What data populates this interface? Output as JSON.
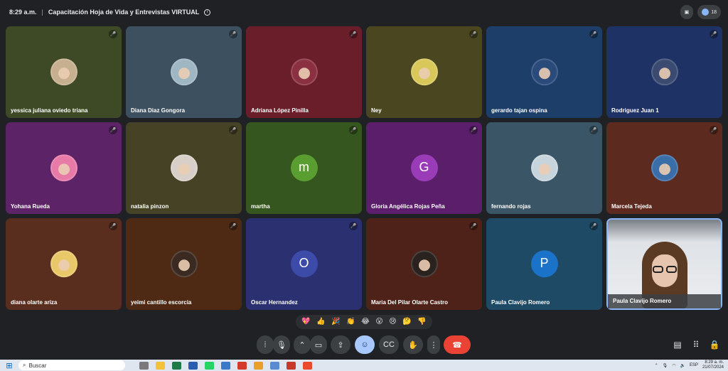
{
  "topbar": {
    "time": "8:29 a.m.",
    "separator": "|",
    "meeting_title": "Capacitación Hoja de Vida y Entrevistas VIRTUAL",
    "participant_count": "18"
  },
  "participants": [
    {
      "name": "yessica juliana oviedo triana",
      "bg": "#3d4a25",
      "avatar": "photo",
      "avatar_color": "#c7b08f"
    },
    {
      "name": "Diana Diaz Gongora",
      "bg": "#3c5060",
      "avatar": "photo",
      "avatar_color": "#9fb6c3"
    },
    {
      "name": "Adriana López Pinilla",
      "bg": "#6a1e2a",
      "avatar": "photo",
      "avatar_color": "#8a3040"
    },
    {
      "name": "Ney",
      "bg": "#4a4720",
      "avatar": "photo",
      "avatar_color": "#d8c85a"
    },
    {
      "name": "gerardo tajan ospina",
      "bg": "#1e3e6a",
      "avatar": "photo",
      "avatar_color": "#2a4a7a"
    },
    {
      "name": "Rodriguez Juan 1",
      "bg": "#1e3266",
      "avatar": "photo",
      "avatar_color": "#3a4a70"
    },
    {
      "name": "Yohana Rueda",
      "bg": "#5c2466",
      "avatar": "photo",
      "avatar_color": "#e87aa8"
    },
    {
      "name": "natalia pinzon",
      "bg": "#454226",
      "avatar": "photo",
      "avatar_color": "#d8d0c8"
    },
    {
      "name": "martha",
      "bg": "#35561e",
      "avatar": "m",
      "avatar_color": "#5a9e32"
    },
    {
      "name": "Gloria Angélica Rojas Peña",
      "bg": "#5a1e6a",
      "avatar": "G",
      "avatar_color": "#9a3cb8"
    },
    {
      "name": "fernando rojas",
      "bg": "#3a5666",
      "avatar": "photo",
      "avatar_color": "#c8d4dc"
    },
    {
      "name": "Marcela Tejeda",
      "bg": "#5c2a1e",
      "avatar": "photo",
      "avatar_color": "#3a6ea8"
    },
    {
      "name": "diana olarte ariza",
      "bg": "#5a2e1e",
      "avatar": "photo",
      "avatar_color": "#e8c868"
    },
    {
      "name": "yeimi cantillo escorcia",
      "bg": "#4e2a14",
      "avatar": "photo",
      "avatar_color": "#3a2a22"
    },
    {
      "name": "Oscar Hernandez",
      "bg": "#2a3070",
      "avatar": "O",
      "avatar_color": "#3c4aa8"
    },
    {
      "name": "Maria Del Pilar Olarte Castro",
      "bg": "#4e2218",
      "avatar": "photo",
      "avatar_color": "#2a221e"
    },
    {
      "name": "Paula Clavijo Romero",
      "bg": "#1e4a66",
      "avatar": "P",
      "avatar_color": "#1a73c8"
    }
  ],
  "self_tile": {
    "name": "Paula Clavijo Romero"
  },
  "reactions": [
    "💖",
    "👍",
    "🎉",
    "👏",
    "😂",
    "😮",
    "😢",
    "🤔",
    "👎"
  ],
  "controls": {
    "captions_icon": "mic-bars-icon",
    "mic_icon": "microphone-icon",
    "more_options_icon": "chevron-up-icon",
    "camera_icon": "camera-icon",
    "present_icon": "present-screen-icon",
    "emoji_icon": "emoji-icon",
    "cc_icon": "closed-captions-icon",
    "hand_icon": "raise-hand-icon",
    "more_icon": "more-vert-icon",
    "leave_icon": "hang-up-icon",
    "chat_icon": "chat-icon",
    "activities_icon": "apps-grid-icon",
    "host_icon": "lock-person-icon"
  },
  "taskbar": {
    "search_label": "Buscar",
    "lang": "ESP",
    "clock_time": "8:29 a. m.",
    "clock_date": "21/07/2024"
  },
  "colors": {
    "background": "#202124",
    "accent": "#8ab4f8",
    "leave": "#ea4335"
  }
}
